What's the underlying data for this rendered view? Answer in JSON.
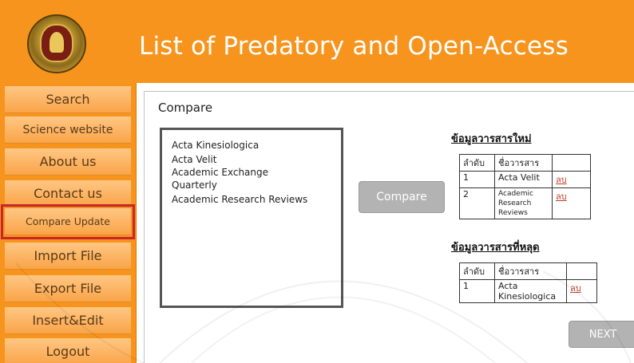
{
  "header": {
    "title": "List of Predatory and Open-Access",
    "logo": "university-seal"
  },
  "sidebar": {
    "items": [
      {
        "label": "Search"
      },
      {
        "label": "Science website"
      },
      {
        "label": "About us"
      },
      {
        "label": "Contact us"
      },
      {
        "label": "Compare Update",
        "highlighted": true
      },
      {
        "label": "Import File"
      },
      {
        "label": "Export File"
      },
      {
        "label": "Insert&Edit"
      },
      {
        "label": "Logout"
      }
    ]
  },
  "main": {
    "title": "Compare",
    "journal_list": [
      "Acta Kinesiologica",
      "Acta Velit",
      "Academic Exchange",
      "Quarterly",
      "Academic Research Reviews"
    ],
    "compare_button": "Compare",
    "new_section": {
      "title": "ข้อมูลวารสารใหม่",
      "header": [
        "ลำดับ",
        "ชื่อวารสาร"
      ],
      "rows": [
        {
          "no": "1",
          "name": "Acta Velit",
          "action": "ลบ"
        },
        {
          "no": "2",
          "name_lines": [
            "Academic",
            "Research",
            "Reviews"
          ],
          "action": "ลบ"
        }
      ]
    },
    "removed_section": {
      "title": "ข้อมูลวารสารที่หลุด",
      "header": [
        "ลำดับ",
        "ชื่อวารสาร"
      ],
      "rows": [
        {
          "no": "1",
          "name_lines": [
            "Acta",
            "Kinesiologica"
          ],
          "action": "ลบ"
        }
      ]
    },
    "next_button": "NEXT"
  },
  "colors": {
    "header_bg": "#f7941d",
    "nav_item": "#ffc784",
    "highlight_border": "#c8262a",
    "button_gray": "#b3b3b3"
  }
}
